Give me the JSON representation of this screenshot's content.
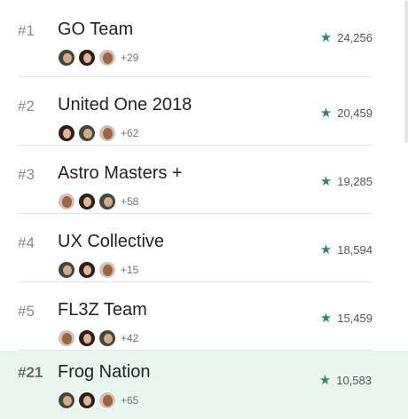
{
  "leaderboard": [
    {
      "rank": "#1",
      "name": "GO Team",
      "more": "+29",
      "score": "24,256",
      "avatars": [
        "a",
        "b",
        "c"
      ]
    },
    {
      "rank": "#2",
      "name": "United One 2018",
      "more": "+62",
      "score": "20,459",
      "avatars": [
        "b",
        "a",
        "c"
      ]
    },
    {
      "rank": "#3",
      "name": "Astro Masters +",
      "more": "+58",
      "score": "19,285",
      "avatars": [
        "c",
        "b",
        "a"
      ]
    },
    {
      "rank": "#4",
      "name": "UX Collective",
      "more": "+15",
      "score": "18,594",
      "avatars": [
        "a",
        "b",
        "c"
      ]
    },
    {
      "rank": "#5",
      "name": "FL3Z Team",
      "more": "+42",
      "score": "15,459",
      "avatars": [
        "c",
        "b",
        "a"
      ]
    }
  ],
  "current_team": {
    "rank": "#21",
    "name": "Frog Nation",
    "more": "+65",
    "score": "10,583",
    "avatars": [
      "a",
      "b",
      "c"
    ]
  },
  "icons": {
    "score": "star-icon",
    "member": "avatar"
  },
  "colors": {
    "accent": "#2f8a66",
    "highlight_bg": "#e9f6ef"
  }
}
